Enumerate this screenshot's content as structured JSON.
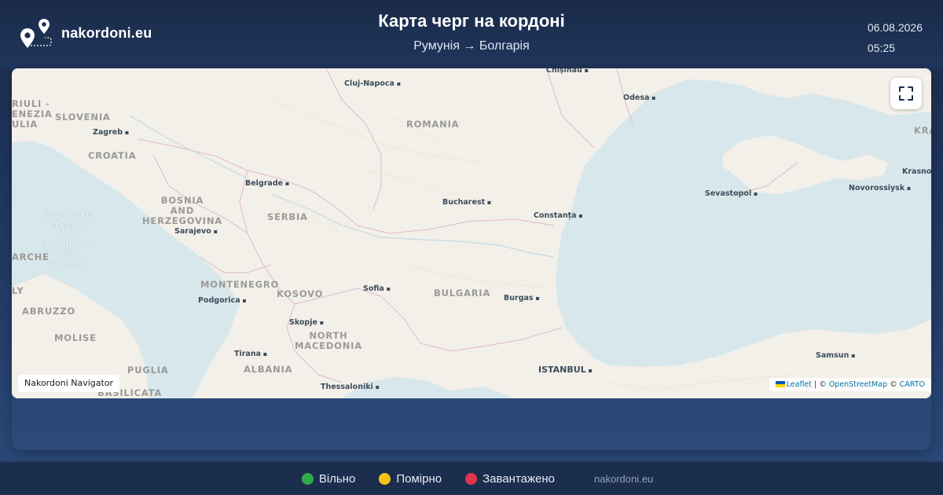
{
  "header": {
    "site_name": "nakordoni.eu",
    "title": "Карта черг на кордоні",
    "route": "Румунія → Болгарія",
    "date": "06.08.2026",
    "time": "05:25"
  },
  "map": {
    "navigator_tag": "Nakordoni Navigator",
    "fullscreen_icon": "fullscreen-icon",
    "attribution": {
      "leaflet": "Leaflet",
      "separator": "| ©",
      "osm": "OpenStreetMap",
      "copy": "©",
      "carto": "CARTO"
    },
    "countries": {
      "friuli": "RIULI -\nENEZIA\nULIA",
      "slovenia": "SLOVENIA",
      "croatia": "CROATIA",
      "bosnia": "BOSNIA\nAND\nHERZEGOVINA",
      "serbia": "SERBIA",
      "romania": "ROMANIA",
      "montenegro": "MONTENEGRO",
      "kosovo": "KOSOVO",
      "bulgaria": "BULGARIA",
      "north_macedonia": "NORTH\nMACEDONIA",
      "albania": "ALBANIA",
      "marche": "ARCHE",
      "lazio": "LY",
      "abruzzo": "ABRUZZO",
      "molise": "MOLISE",
      "puglia": "PUGLIA",
      "basilicata": "BASILICATA",
      "krasnodar": "KRA"
    },
    "seas": {
      "adriatic": "Jadransko\nmore /\nMare\nAdriatico /\nDeti\nAdriatik"
    },
    "cities": {
      "cluj": "Cluj-Napoca",
      "chisinau": "Chișinău",
      "odesa": "Odesa",
      "zagreb": "Zagreb",
      "belgrade": "Belgrade",
      "bucharest": "Bucharest",
      "constanta": "Constanța",
      "sevastopol": "Sevastopol",
      "novorossiysk": "Novorossiysk",
      "krasnodar": "Krasnoda",
      "sarajevo": "Sarajevo",
      "sofia": "Sofia",
      "burgas": "Burgas",
      "podgorica": "Podgorica",
      "skopje": "Skopje",
      "tirana": "Tirana",
      "istanbul": "ISTANBUL",
      "thessaloniki": "Thessaloniki",
      "samsun": "Samsun"
    }
  },
  "legend": {
    "free": {
      "label": "Вільно",
      "color": "#2eab4b"
    },
    "moderate": {
      "label": "Помірно",
      "color": "#f6c315"
    },
    "busy": {
      "label": "Завантажено",
      "color": "#e0364a"
    }
  },
  "footer": {
    "site": "nakordoni.eu"
  }
}
